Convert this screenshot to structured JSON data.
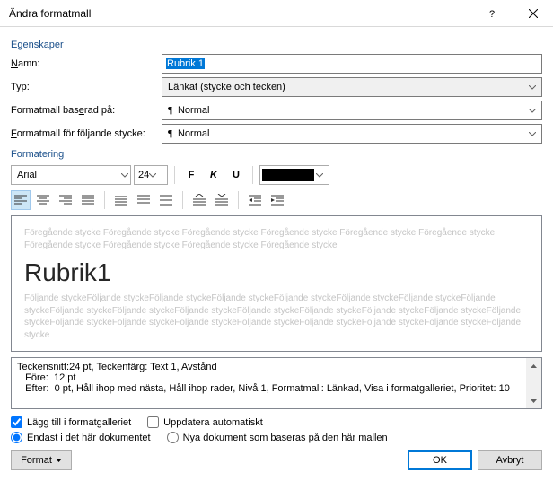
{
  "title": "Ändra formatmall",
  "section_properties": "Egenskaper",
  "labels": {
    "name": "Namn:",
    "type": "Typ:",
    "based_on": "Formatmall baserad på:",
    "following": "Formatmall för följande stycke:"
  },
  "values": {
    "name": "Rubrik 1",
    "type": "Länkat (stycke och tecken)",
    "based_on": "Normal",
    "following": "Normal"
  },
  "section_formatting": "Formatering",
  "font": {
    "name": "Arial",
    "size": "24"
  },
  "preview": {
    "before": "Föregående stycke Föregående stycke Föregående stycke Föregående stycke Föregående stycke Föregående stycke Föregående stycke Föregående stycke Föregående stycke Föregående stycke",
    "heading": "Rubrik1",
    "after": "Följande styckeFöljande styckeFöljande styckeFöljande styckeFöljande styckeFöljande styckeFöljande styckeFöljande styckeFöljande styckeFöljande styckeFöljande styckeFöljande styckeFöljande styckeFöljande styckeFöljande styckeFöljande styckeFöljande styckeFöljande styckeFöljande styckeFöljande styckeFöljande styckeFöljande styckeFöljande styckeFöljande stycke"
  },
  "description": {
    "line1": "Teckensnitt:24 pt, Teckenfärg: Text 1, Avstånd",
    "line2": "   Före:  12 pt",
    "line3": "   Efter:  0 pt, Håll ihop med nästa, Håll ihop rader, Nivå 1, Formatmall: Länkad, Visa i formatgalleriet, Prioritet: 10"
  },
  "checkboxes": {
    "add_to_gallery": "Lägg till i formatgalleriet",
    "auto_update": "Uppdatera automatiskt"
  },
  "radios": {
    "this_doc": "Endast i det här dokumentet",
    "new_docs": "Nya dokument som baseras på den här mallen"
  },
  "buttons": {
    "format": "Format",
    "ok": "OK",
    "cancel": "Avbryt"
  }
}
